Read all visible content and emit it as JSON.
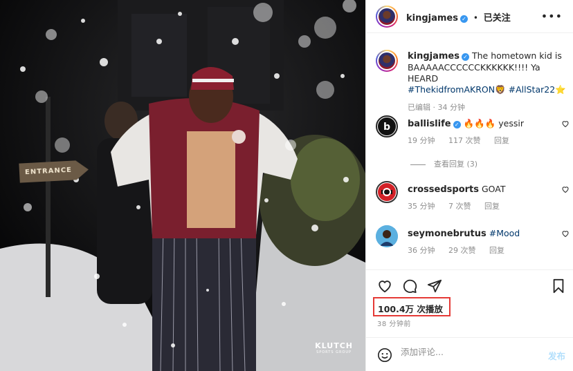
{
  "media": {
    "sign_text": "ENTRANCE",
    "brand_line1": "KLUTCH",
    "brand_line2": "SPORTS GROUP"
  },
  "header": {
    "username": "kingjames",
    "verified_badge": "✓",
    "separator": "•",
    "follow_label": "已关注",
    "more_icon": "•••"
  },
  "caption": {
    "username": "kingjames",
    "text": "The hometown kid is BAAAAACCCCCCKKKKKK!!!! Ya HEARD",
    "hashtag1": "#ThekidfromAKRON",
    "emoji1": "🦁",
    "hashtag2": "#AllStar22",
    "emoji2": "⭐",
    "edited": "已编辑",
    "dot": "·",
    "time": "34 分钟"
  },
  "comments": [
    {
      "username": "ballislife",
      "verified": true,
      "text": "🔥🔥🔥 yessir",
      "time": "19 分钟",
      "likes": "117 次赞",
      "reply": "回复"
    },
    {
      "username": "crossedsports",
      "verified": false,
      "text": "GOAT",
      "time": "35 分钟",
      "likes": "7 次赞",
      "reply": "回复"
    },
    {
      "username": "seymonebrutus",
      "verified": false,
      "text": "#Mood",
      "time": "36 分钟",
      "likes": "29 次赞",
      "reply": "回复"
    }
  ],
  "view_replies": "查看回复 (3)",
  "stats": {
    "views": "100.4万 次播放",
    "posted_ago": "38 分钟前"
  },
  "add_comment": {
    "placeholder": "添加评论...",
    "post_label": "发布"
  },
  "colors": {
    "link": "#00376b",
    "verified": "#3897f0",
    "highlight_box": "#e53935",
    "post_disabled": "#b2dffc"
  }
}
